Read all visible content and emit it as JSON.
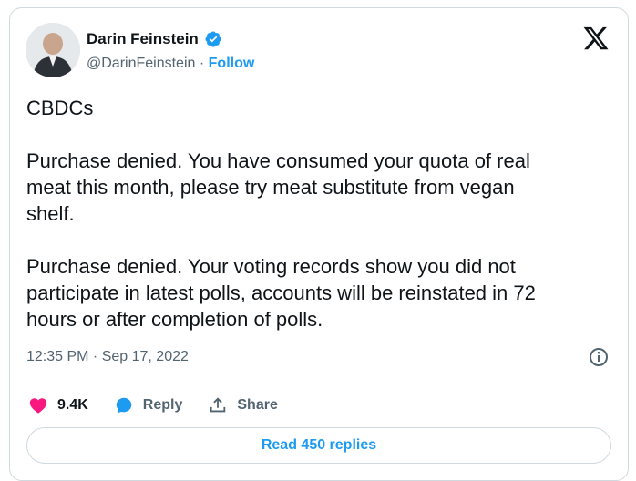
{
  "author": {
    "name": "Darin Feinstein",
    "handle": "@DarinFeinstein",
    "separator": "·",
    "follow_label": "Follow"
  },
  "tweet": {
    "text": "CBDCs\n\nPurchase denied. You have consumed your quota of real\nmeat this month, please try meat substitute from vegan\nshelf.\n\nPurchase denied. Your voting records show you did not\nparticipate in latest polls, accounts will be reinstated in 72\nhours or after completion of polls.",
    "timestamp": "12:35 PM · Sep 17, 2022"
  },
  "actions": {
    "likes": "9.4K",
    "reply_label": "Reply",
    "share_label": "Share"
  },
  "replies_button": "Read 450 replies",
  "colors": {
    "accent": "#1d9bf0",
    "like": "#f91880",
    "muted": "#536471",
    "border": "#cfd9de"
  }
}
